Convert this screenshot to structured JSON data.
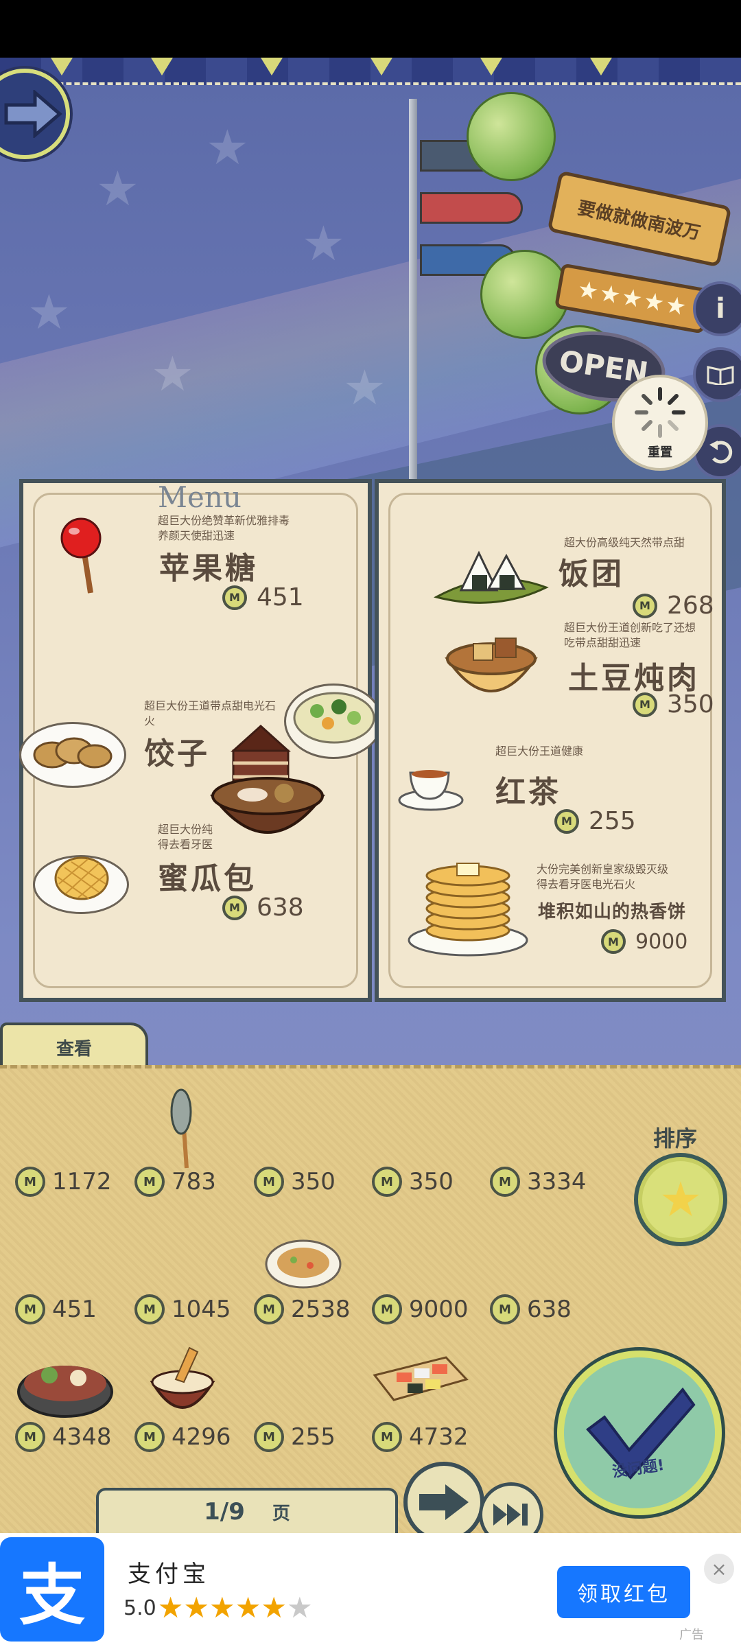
{
  "scene": {
    "shop_sign": "要做就做南波万",
    "rating_stars": "★★★★★",
    "open_sign": "OPEN",
    "reset_label": "重置",
    "info_icon": "i"
  },
  "menu": {
    "title": "Menu",
    "left_page": [
      {
        "desc": "超巨大份绝赞革新优雅排毒\n养颜天使甜迅速",
        "name": "苹果糖",
        "price": "451"
      },
      {
        "desc": "超巨大份王道带点甜电光石\n火",
        "name": "饺子",
        "price": ""
      },
      {
        "desc": "超巨大份纯\n得去看牙医",
        "name": "蜜瓜包",
        "price": "638"
      }
    ],
    "right_page": [
      {
        "desc": "超大份高级纯天然带点甜",
        "name": "饭团",
        "price": "268"
      },
      {
        "desc": "超巨大份王道创新吃了还想\n吃带点甜甜迅速",
        "name": "土豆炖肉",
        "price": "350"
      },
      {
        "desc": "超巨大份王道健康",
        "name": "红茶",
        "price": "255"
      },
      {
        "desc": "大份完美创新皇家级毁灭级\n得去看牙医电光石火",
        "name": "堆积如山的热香饼",
        "price": "9000"
      }
    ]
  },
  "catalog": {
    "tab_label": "查看",
    "sort_label": "排序",
    "confirm_label": "没问题!",
    "items": [
      "1172",
      "783",
      "350",
      "350",
      "3334",
      "451",
      "1045",
      "2538",
      "9000",
      "638",
      "4348",
      "4296",
      "255",
      "4732"
    ],
    "page": "1/9",
    "page_unit": "页"
  },
  "ad": {
    "app_name": "支付宝",
    "logo_char": "支",
    "rating": "5.0",
    "stars_on": 5,
    "cta": "领取红包",
    "close": "×",
    "tag": "广告"
  },
  "colors": {
    "accent": "#1677ff",
    "paper": "#f2e7cf",
    "panel": "#e3cb8b",
    "coin": "#d8da7a"
  }
}
